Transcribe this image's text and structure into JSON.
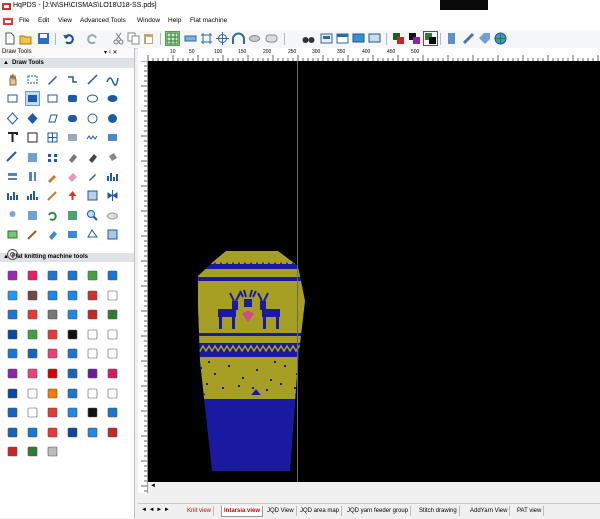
{
  "window": {
    "title": "HqPDS - [J:\\N\\SH\\CISMAS\\LO18\\J18-SS.pds]"
  },
  "menu": {
    "items": [
      "File",
      "Edit",
      "View",
      "Advanced Tools",
      "Window",
      "Help",
      "Flat machine"
    ]
  },
  "panel": {
    "title": "Draw Tools",
    "pin": "▾ ♮ ✕",
    "sections": [
      {
        "label": "Draw Tools",
        "expanded": true
      },
      {
        "label": "Flat knitting machine tools",
        "expanded": true
      }
    ]
  },
  "ruler": {
    "labels": [
      "10",
      "50",
      "100",
      "150",
      "200",
      "250",
      "300",
      "350",
      "400",
      "450",
      "500"
    ]
  },
  "tabs": {
    "nav": "◄ ◄ ► ►",
    "items": [
      {
        "label": "Knit view",
        "style": "red"
      },
      {
        "label": "Intarsia view",
        "style": "active"
      },
      {
        "label": "JQD View",
        "style": "normal"
      },
      {
        "label": "JQD area map",
        "style": "normal"
      },
      {
        "label": "JQD yarn feeder group",
        "style": "normal"
      },
      {
        "label": "Stitch drawing",
        "style": "normal"
      },
      {
        "label": "AddYarn View",
        "style": "normal"
      },
      {
        "label": "PAT view",
        "style": "normal"
      }
    ]
  },
  "design": {
    "colors": {
      "body": "#1a1aa0",
      "contrast": "#a79f23",
      "pink": "#d24b8e",
      "white": "#ffffff"
    },
    "motif": "reindeer"
  },
  "colors": {
    "accent": "#c5d9f1",
    "active_tab_text": "#d10000",
    "canvas_bg": "#000000"
  }
}
